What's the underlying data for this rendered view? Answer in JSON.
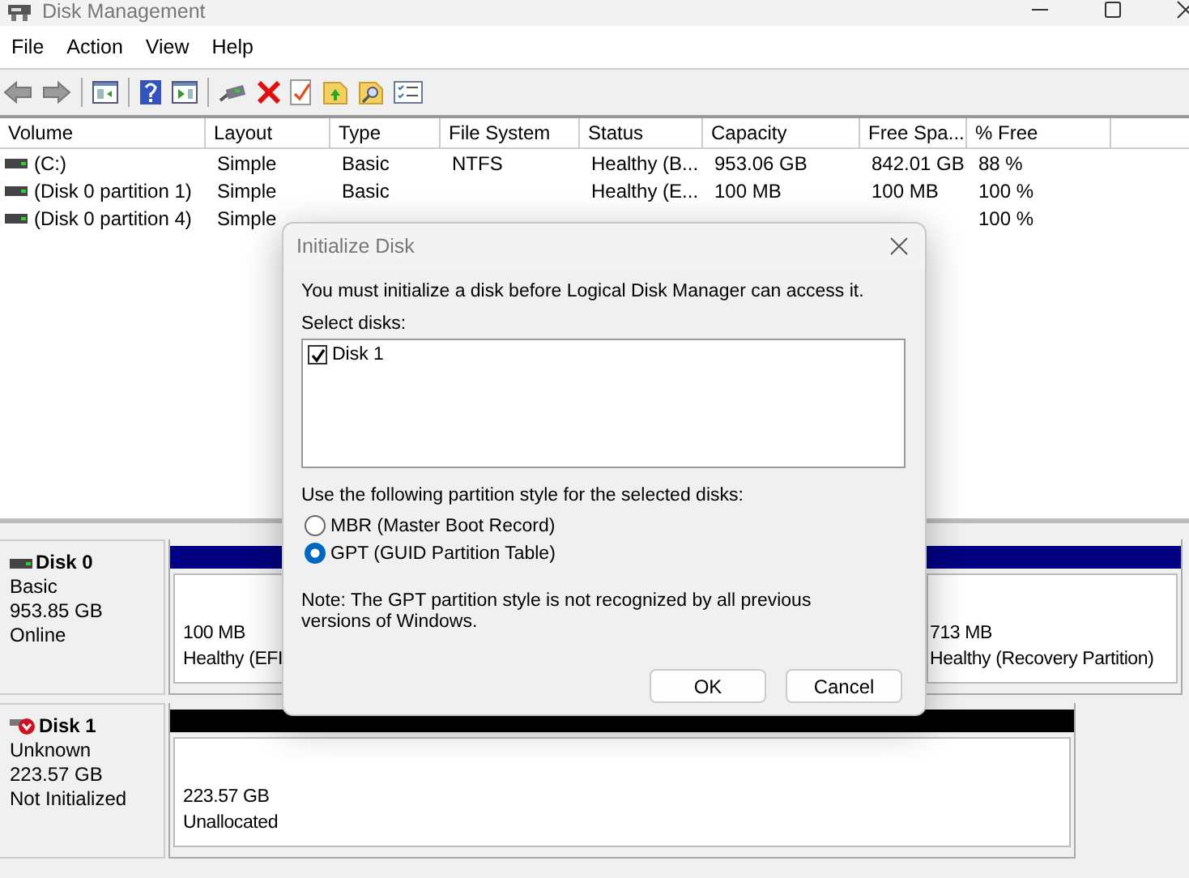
{
  "window": {
    "title": "Disk Management"
  },
  "menu": [
    "File",
    "Action",
    "View",
    "Help"
  ],
  "volumes": {
    "columns": [
      "Volume",
      "Layout",
      "Type",
      "File System",
      "Status",
      "Capacity",
      "Free Spa...",
      "% Free"
    ],
    "rows": [
      {
        "cells": [
          "(C:)",
          "Simple",
          "Basic",
          "NTFS",
          "Healthy (B...",
          "953.06 GB",
          "842.01 GB",
          "88 %"
        ]
      },
      {
        "cells": [
          "(Disk 0 partition 1)",
          "Simple",
          "Basic",
          null,
          "Healthy (E...",
          "100 MB",
          "100 MB",
          "100 %"
        ]
      },
      {
        "cells": [
          "(Disk 0 partition 4)",
          "Simple",
          null,
          null,
          null,
          null,
          null,
          "100 %"
        ]
      }
    ]
  },
  "disks": [
    {
      "name": "Disk 0",
      "kind": "online",
      "type": "Basic",
      "size": "953.85 GB",
      "status": "Online",
      "color": "#000080",
      "partitions": [
        {
          "size": "100 MB",
          "status": "Healthy (EFI"
        },
        {
          "size": "713 MB",
          "status": "Healthy (Recovery Partition)"
        }
      ]
    },
    {
      "name": "Disk 1",
      "kind": "not_initialized",
      "type": "Unknown",
      "size": "223.57 GB",
      "status": "Not Initialized",
      "color": "#000000",
      "partitions": [
        {
          "size": "223.57 GB",
          "status": "Unallocated"
        }
      ]
    }
  ],
  "dialog": {
    "title": "Initialize Disk",
    "message": "You must initialize a disk before Logical Disk Manager can access it.",
    "select_label": "Select disks:",
    "disks": [
      {
        "label": "Disk 1",
        "checked": true
      }
    ],
    "style_label": "Use the following partition style for the selected disks:",
    "styles": [
      {
        "label": "MBR (Master Boot Record)",
        "selected": false
      },
      {
        "label": "GPT (GUID Partition Table)",
        "selected": true
      }
    ],
    "note": "Note: The GPT partition style is not recognized by all previous versions of Windows.",
    "buttons": [
      "OK",
      "Cancel"
    ]
  }
}
